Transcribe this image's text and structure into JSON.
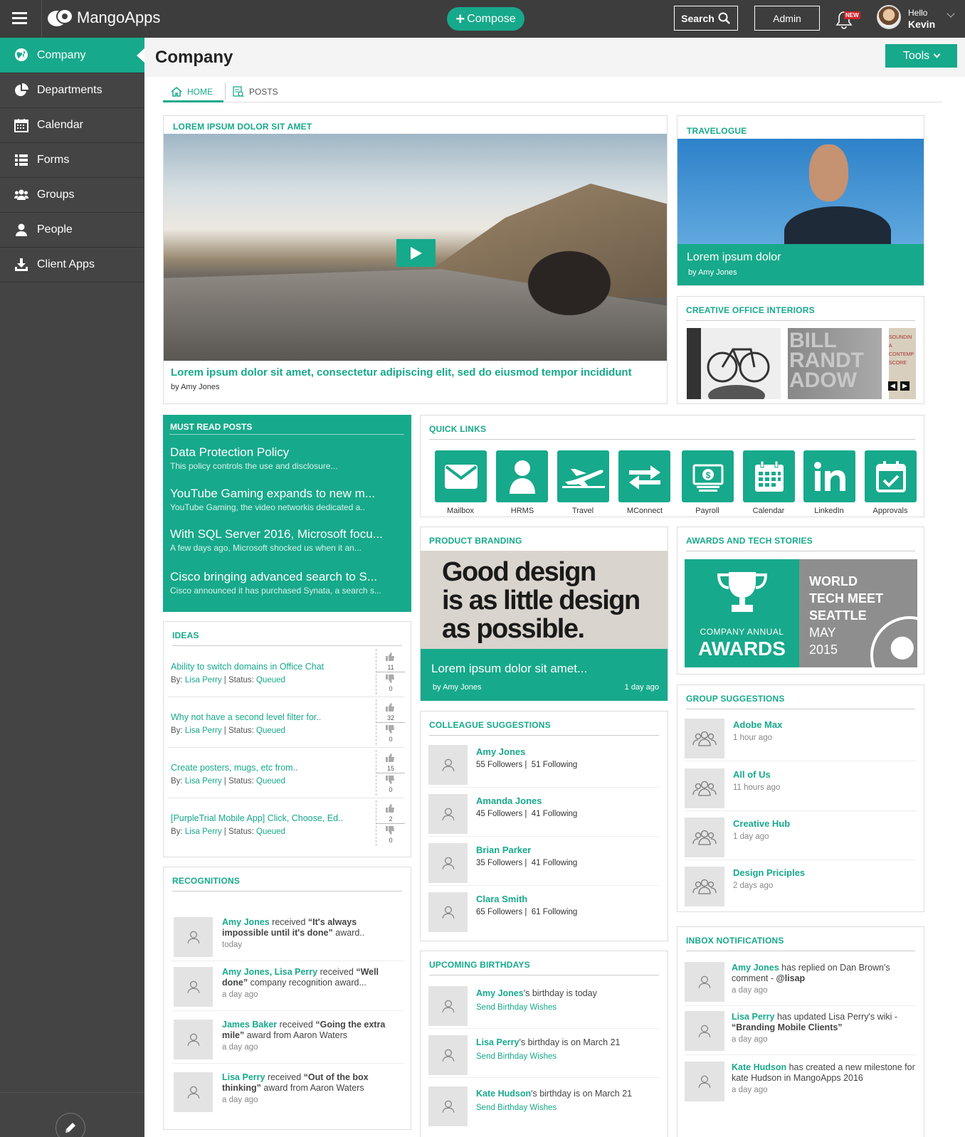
{
  "header": {
    "logo": "MangoApps",
    "compose": "Compose",
    "search": "Search",
    "admin": "Admin",
    "notif_badge": "NEW",
    "hello": "Hello",
    "user": "Kevin"
  },
  "sidebar": {
    "items": [
      {
        "label": "Company",
        "icon": "globe-icon"
      },
      {
        "label": "Departments",
        "icon": "pie-chart-icon"
      },
      {
        "label": "Calendar",
        "icon": "calendar-icon"
      },
      {
        "label": "Forms",
        "icon": "list-icon"
      },
      {
        "label": "Groups",
        "icon": "users-icon"
      },
      {
        "label": "People",
        "icon": "user-icon"
      },
      {
        "label": "Client Apps",
        "icon": "download-icon"
      }
    ]
  },
  "page": {
    "title": "Company",
    "tools": "Tools",
    "tabs": [
      "HOME",
      "POSTS"
    ]
  },
  "feature": {
    "heading": "LOREM IPSUM DOLOR SIT AMET",
    "title": "Lorem ipsum dolor sit amet, consectetur adipiscing elit, sed do eiusmod tempor incididunt",
    "by": "by Amy Jones"
  },
  "travelogue": {
    "heading": "TRAVELOGUE",
    "title": "Lorem ipsum dolor",
    "by": "by Amy Jones"
  },
  "office": {
    "heading": "CREATIVE OFFICE INTERIORS",
    "thumb2_text": "BILL RANDT ADOW",
    "thumb3_text": "SOUNDIN A CONTEMP SCORE"
  },
  "must_read": {
    "heading": "MUST READ POSTS",
    "posts": [
      {
        "title": "Data Protection Policy",
        "desc": "This policy controls the use and disclosure..."
      },
      {
        "title": "YouTube Gaming expands to new m...",
        "desc": "YouTube Gaming, the video networkis dedicated a.."
      },
      {
        "title": "With SQL Server 2016, Microsoft focu...",
        "desc": "A few days ago, Microsoft shocked us when it an..."
      },
      {
        "title": "Cisco bringing advanced search to S...",
        "desc": "Cisco announced it has purchased Synata, a search s..."
      }
    ]
  },
  "quick_links": {
    "heading": "QUICK LINKS",
    "items": [
      {
        "label": "Mailbox",
        "icon": "mail-icon"
      },
      {
        "label": "HRMS",
        "icon": "person-icon"
      },
      {
        "label": "Travel",
        "icon": "airplane-icon"
      },
      {
        "label": "MConnect",
        "icon": "exchange-icon"
      },
      {
        "label": "Payroll",
        "icon": "money-icon"
      },
      {
        "label": "Calendar",
        "icon": "calendar-icon"
      },
      {
        "label": "LinkedIn",
        "icon": "linkedin-icon"
      },
      {
        "label": "Approvals",
        "icon": "approval-icon"
      }
    ]
  },
  "ideas": {
    "heading": "IDEAS",
    "by_label": "By:",
    "status_label": "Status:",
    "items": [
      {
        "title": "Ability to switch domains in Office Chat",
        "author": "Lisa Perry",
        "status": "Queued",
        "up": "11",
        "down": "0"
      },
      {
        "title": "Why not have a second level filter for..",
        "author": "Lisa Perry",
        "status": "Queued",
        "up": "32",
        "down": "0"
      },
      {
        "title": "Create posters, mugs, etc from..",
        "author": "Lisa Perry",
        "status": "Queued",
        "up": "15",
        "down": "0"
      },
      {
        "title": "[PurpleTrial Mobile App] Click, Choose, Ed..",
        "author": "Lisa Perry",
        "status": "Queued",
        "up": "2",
        "down": "0"
      }
    ]
  },
  "branding": {
    "heading": "PRODUCT BRANDING",
    "quote1": "Good design",
    "quote2": "is as little design",
    "quote3": "as possible.",
    "title": "Lorem ipsum dolor sit amet...",
    "by": "by Amy Jones",
    "time": "1 day ago"
  },
  "awards": {
    "heading": "AWARDS AND TECH STORIES",
    "line1": "COMPANY ANNUAL",
    "line2": "AWARDS",
    "event1": "WORLD",
    "event2": "TECH MEET",
    "event3": "SEATTLE",
    "event4": "MAY",
    "event5": "2015"
  },
  "colleagues": {
    "heading": "COLLEAGUE SUGGESTIONS",
    "items": [
      {
        "name": "Amy Jones",
        "stats": "55 Followers |  51 Following"
      },
      {
        "name": "Amanda Jones",
        "stats": "45 Followers |  41 Following"
      },
      {
        "name": "Brian Parker",
        "stats": "35 Followers |  41 Following"
      },
      {
        "name": "Clara Smith",
        "stats": "65 Followers |  61 Following"
      }
    ]
  },
  "groups": {
    "heading": "GROUP SUGGESTIONS",
    "items": [
      {
        "name": "Adobe Max",
        "time": "1 hour ago"
      },
      {
        "name": "All of Us",
        "time": "11 hours ago"
      },
      {
        "name": "Creative Hub",
        "time": "1 day ago"
      },
      {
        "name": "Design Priciples",
        "time": "2 days ago"
      }
    ]
  },
  "recognitions": {
    "heading": "RECOGNITIONS",
    "items": [
      {
        "who": "Amy Jones",
        "mid": " received ",
        "award": "“It's always impossible until it's done”",
        "tail": " award..",
        "time": "today"
      },
      {
        "who": "Amy Jones, Lisa Perry",
        "mid": " received ",
        "award": "“Well done”",
        "tail": " company recognition award...",
        "time": "a day ago"
      },
      {
        "who": "James Baker",
        "mid": " received ",
        "award": "“Going the extra mile”",
        "tail": " award from Aaron Waters",
        "time": "a day ago"
      },
      {
        "who": "Lisa Perry",
        "mid": " received ",
        "award": "“Out of the box thinking”",
        "tail": " award from Aaron Waters",
        "time": "a day ago"
      }
    ]
  },
  "birthdays": {
    "heading": "UPCOMING BIRTHDAYS",
    "wish": "Send Birthday Wishes",
    "items": [
      {
        "name": "Amy Jones",
        "text": "'s birthday is today"
      },
      {
        "name": "Lisa Perry",
        "text": "'s birthday is on March 21"
      },
      {
        "name": "Kate Hudson",
        "text": "'s birthday is on March 21"
      }
    ]
  },
  "inbox": {
    "heading": "INBOX NOTIFICATIONS",
    "items": [
      {
        "who": "Amy Jones",
        "text": " has replied on Dan Brown's comment - ",
        "bold": "@lisap",
        "time": "a day ago"
      },
      {
        "who": "Lisa Perry",
        "text": " has updated Lisa Perry's wiki - ",
        "bold": "“Branding Mobile Clients”",
        "time": "a day ago"
      },
      {
        "who": "Kate Hudson",
        "text": " has created a new milestone for kate Hudson in MangoApps 2016",
        "bold": "",
        "time": "a day ago"
      }
    ]
  },
  "colors": {
    "accent": "#17a98b",
    "topbar": "#3d3d3d",
    "sidebar": "#444444"
  }
}
